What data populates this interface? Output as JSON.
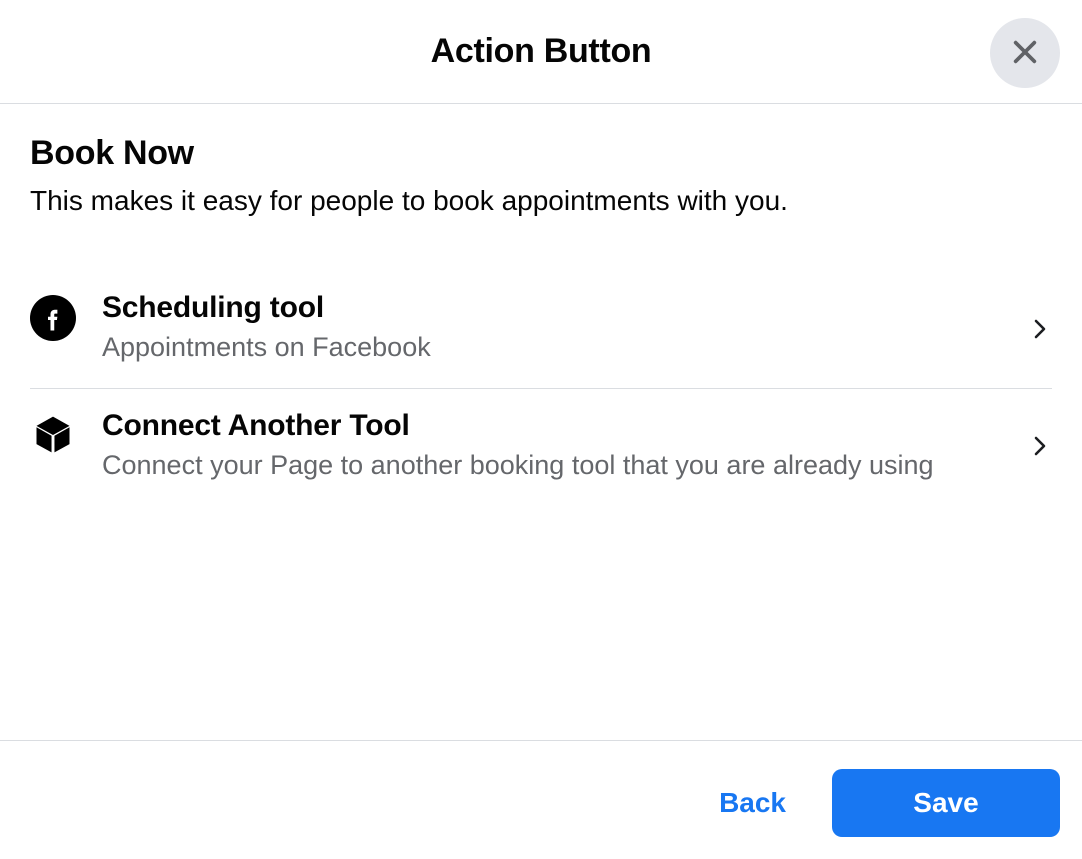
{
  "header": {
    "title": "Action Button"
  },
  "section": {
    "title": "Book Now",
    "subtitle": "This makes it easy for people to book appointments with you."
  },
  "options": [
    {
      "title": "Scheduling tool",
      "desc": "Appointments on Facebook"
    },
    {
      "title": "Connect Another Tool",
      "desc": "Connect your Page to another booking tool that you are already using"
    }
  ],
  "footer": {
    "back_label": "Back",
    "save_label": "Save"
  }
}
